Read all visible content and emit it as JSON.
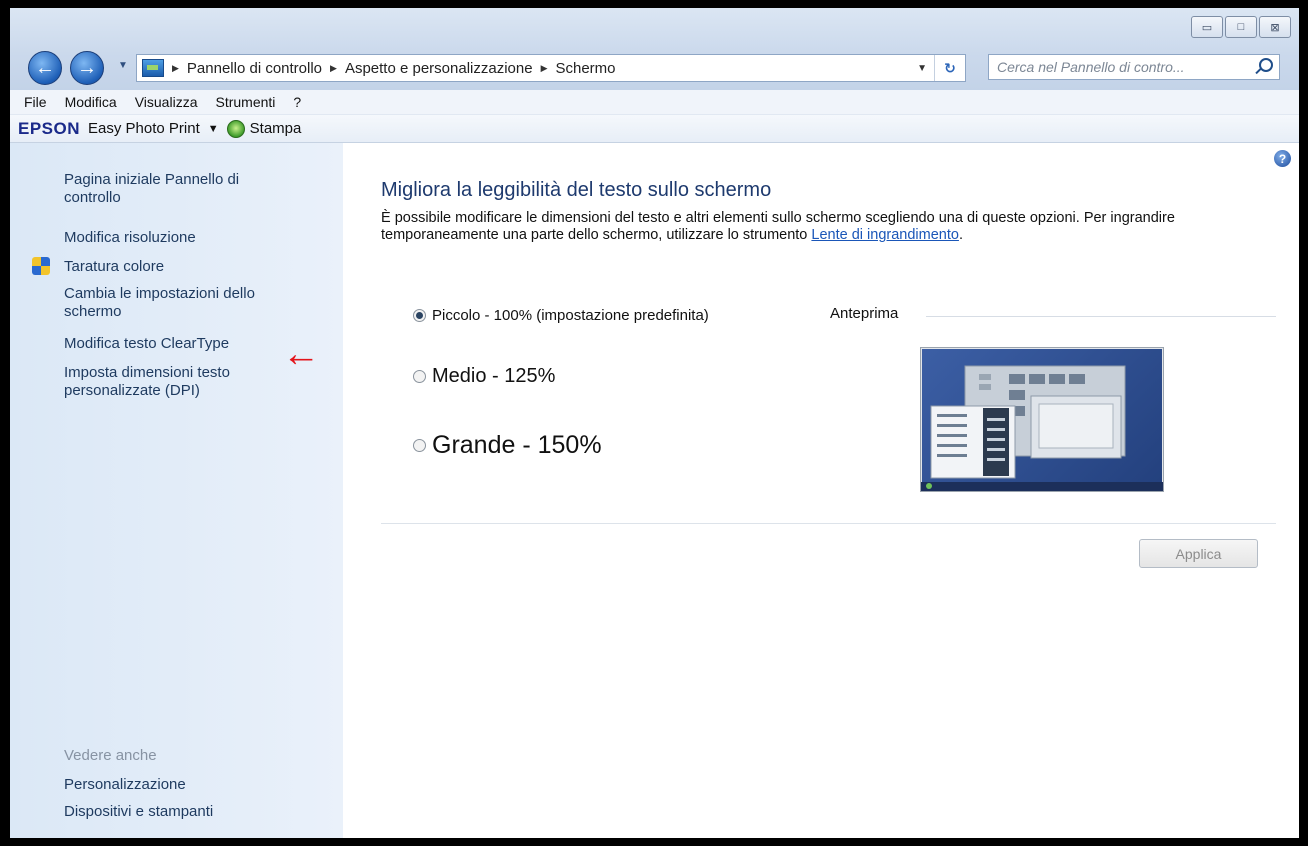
{
  "window": {
    "minimize_label": "▭",
    "maximize_label": "□",
    "close_label": "⊠"
  },
  "nav": {
    "back_label": "←",
    "forward_label": "→",
    "refresh_label": "↻"
  },
  "breadcrumb": {
    "items": [
      "Pannello di controllo",
      "Aspetto e personalizzazione",
      "Schermo"
    ]
  },
  "search": {
    "placeholder": "Cerca nel Pannello di contro..."
  },
  "menu": {
    "items": [
      "File",
      "Modifica",
      "Visualizza",
      "Strumenti",
      "?"
    ]
  },
  "epson": {
    "logo": "EPSON",
    "app": "Easy Photo Print",
    "print_label": "Stampa"
  },
  "sidebar": {
    "links": [
      "Pagina iniziale Pannello di controllo",
      "Modifica risoluzione",
      "Taratura colore",
      "Cambia le impostazioni dello schermo",
      "Modifica testo ClearType",
      "Imposta dimensioni testo personalizzate (DPI)"
    ],
    "see_also_title": "Vedere anche",
    "see_also": [
      "Personalizzazione",
      "Dispositivi e stampanti"
    ]
  },
  "main": {
    "title": "Migliora la leggibilità del testo sullo schermo",
    "description": "È possibile modificare le dimensioni del testo e altri elementi sullo schermo scegliendo una di queste opzioni. Per ingrandire temporaneamente una parte dello schermo, utilizzare lo strumento ",
    "link_text": "Lente di ingrandimento",
    "description_end": ".",
    "options": [
      {
        "label": "Piccolo - 100% (impostazione predefinita)",
        "selected": true
      },
      {
        "label": "Medio - 125%",
        "selected": false
      },
      {
        "label": "Grande - 150%",
        "selected": false
      }
    ],
    "preview_label": "Anteprima",
    "apply_label": "Applica"
  },
  "colors": {
    "accent": "#1e3a6e",
    "link": "#1a56b8",
    "arrow": "#e3141b",
    "sidebar": "#dde9f6"
  },
  "icons": [
    "back-icon",
    "forward-icon",
    "control-panel-icon",
    "refresh-icon",
    "search-icon",
    "print-icon",
    "shield-icon",
    "help-icon",
    "red-arrow-icon"
  ]
}
